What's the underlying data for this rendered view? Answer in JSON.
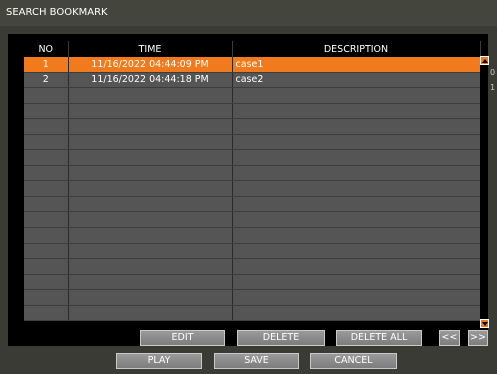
{
  "title": "SEARCH BOOKMARK",
  "table": {
    "headers": [
      "NO",
      "TIME",
      "DESCRIPTION"
    ],
    "rows": [
      {
        "no": "1",
        "time": "11/16/2022  04:44:09 PM",
        "description": "case1",
        "selected": true
      },
      {
        "no": "2",
        "time": "11/16/2022  04:44:18 PM",
        "description": "case2",
        "selected": false
      }
    ],
    "empty_rows": 15
  },
  "side_marks": [
    "0",
    "1"
  ],
  "actions": {
    "edit": "EDIT",
    "delete": "DELETE",
    "delete_all": "DELETE ALL",
    "prev_page": "<<",
    "next_page": ">>"
  },
  "footer": {
    "play": "PLAY",
    "save": "SAVE",
    "cancel": "CANCEL"
  },
  "colors": {
    "selected_row": "#f07a1c",
    "row_bg": "#555555",
    "window_bg": "#3a3b34"
  }
}
